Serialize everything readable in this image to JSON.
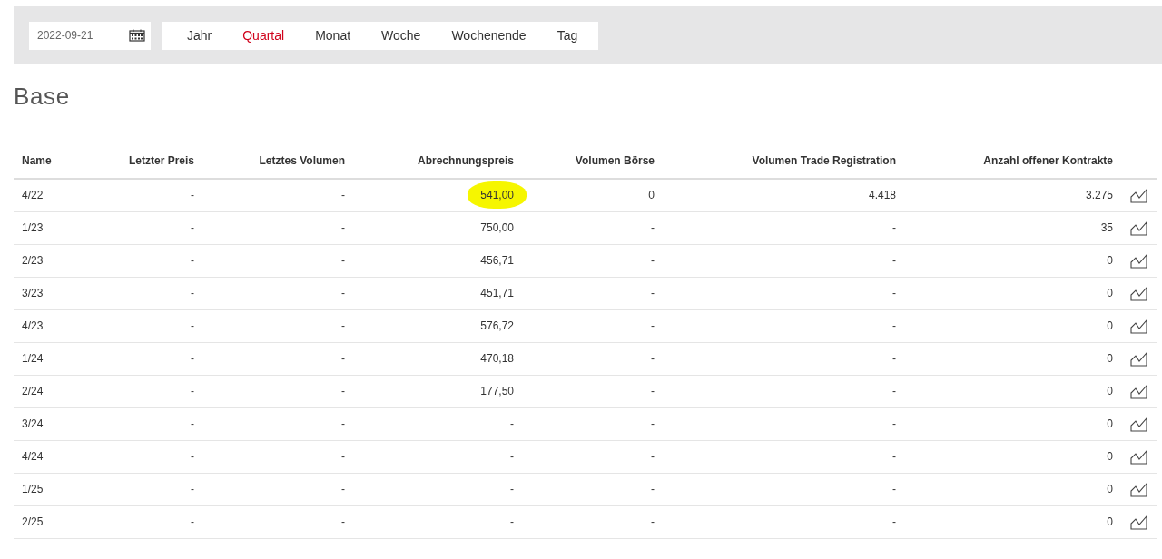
{
  "toolbar": {
    "date_field": {
      "value": "2022-09-21"
    },
    "tabs": [
      {
        "label": "Jahr",
        "selected": false
      },
      {
        "label": "Quartal",
        "selected": true
      },
      {
        "label": "Monat",
        "selected": false
      },
      {
        "label": "Woche",
        "selected": false
      },
      {
        "label": "Wochenende",
        "selected": false
      },
      {
        "label": "Tag",
        "selected": false
      }
    ]
  },
  "heading": "Base",
  "table": {
    "columns": [
      "Name",
      "Letzter Preis",
      "Letztes Volumen",
      "Abrechnungspreis",
      "Volumen Börse",
      "Volumen Trade Registration",
      "Anzahl offener Kontrakte"
    ],
    "rows": [
      {
        "cells": [
          "4/22",
          "-",
          "-",
          "541,00",
          "0",
          "4.418",
          "3.275"
        ],
        "highlighted": true
      },
      {
        "cells": [
          "1/23",
          "-",
          "-",
          "750,00",
          "-",
          "-",
          "35"
        ],
        "highlighted": false
      },
      {
        "cells": [
          "2/23",
          "-",
          "-",
          "456,71",
          "-",
          "-",
          "0"
        ],
        "highlighted": false
      },
      {
        "cells": [
          "3/23",
          "-",
          "-",
          "451,71",
          "-",
          "-",
          "0"
        ],
        "highlighted": false
      },
      {
        "cells": [
          "4/23",
          "-",
          "-",
          "576,72",
          "-",
          "-",
          "0"
        ],
        "highlighted": false
      },
      {
        "cells": [
          "1/24",
          "-",
          "-",
          "470,18",
          "-",
          "-",
          "0"
        ],
        "highlighted": false
      },
      {
        "cells": [
          "2/24",
          "-",
          "-",
          "177,50",
          "-",
          "-",
          "0"
        ],
        "highlighted": false
      },
      {
        "cells": [
          "3/24",
          "-",
          "-",
          "-",
          "-",
          "-",
          "0"
        ],
        "highlighted": false
      },
      {
        "cells": [
          "4/24",
          "-",
          "-",
          "-",
          "-",
          "-",
          "0"
        ],
        "highlighted": false
      },
      {
        "cells": [
          "1/25",
          "-",
          "-",
          "-",
          "-",
          "-",
          "0"
        ],
        "highlighted": false
      },
      {
        "cells": [
          "2/25",
          "-",
          "-",
          "-",
          "-",
          "-",
          "0"
        ],
        "highlighted": false
      }
    ]
  }
}
